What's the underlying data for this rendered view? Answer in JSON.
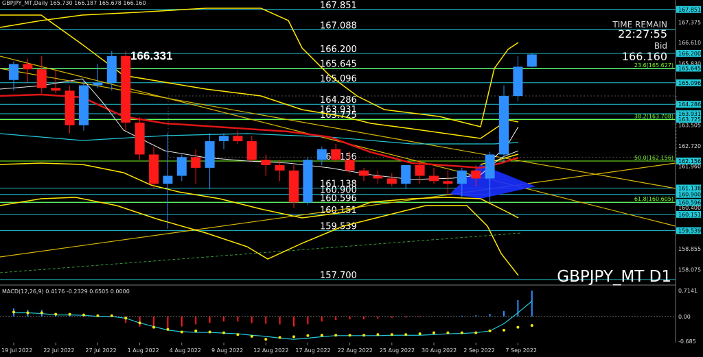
{
  "window": {
    "info_line": "GBPJPY_MT,Daily  165.730 166.187 165.678 166.160",
    "symbol_label": "GBPJPY_MT D1",
    "time_remain_label": "TIME REMAIN",
    "time_remain_value": "22:27:55",
    "bid_label": "Bid",
    "bid_value": "166.160",
    "highlight_price": "166.331"
  },
  "colors": {
    "bull": "#2f8fff",
    "bear": "#ff1a1a",
    "yellow": "#ffe600",
    "cyan": "#22c8d8",
    "red_ma": "#e01515",
    "lime": "#7cff2a",
    "bg": "#000000"
  },
  "chart_data": {
    "type": "candlestick",
    "symbol": "GBPJPY_MT",
    "timeframe": "D1",
    "ylim": [
      157.7,
      168.0
    ],
    "y_ticks": [
      "167.851",
      "167.375",
      "166.610",
      "166.200",
      "165.830",
      "165.645",
      "165.096",
      "164.286",
      "163.931",
      "163.725",
      "163.505",
      "162.720",
      "162.156",
      "161.960",
      "161.138",
      "160.900",
      "160.596",
      "160.400",
      "160.151",
      "159.539",
      "158.855",
      "158.075"
    ],
    "x_tick_labels": [
      "19 Jul 2022",
      "22 Jul 2022",
      "27 Jul 2022",
      "1 Aug 2022",
      "4 Aug 2022",
      "9 Aug 2022",
      "12 Aug 2022",
      "17 Aug 2022",
      "22 Aug 2022",
      "25 Aug 2022",
      "30 Aug 2022",
      "2 Sep 2022",
      "7 Sep 2022"
    ],
    "x_tick_index": [
      0,
      3,
      6,
      9,
      12,
      15,
      18,
      21,
      24,
      27,
      30,
      33,
      36
    ],
    "level_lines": [
      {
        "price": 167.851,
        "label": "167.851"
      },
      {
        "price": 167.088,
        "label": "167.088"
      },
      {
        "price": 166.2,
        "label": "166.200"
      },
      {
        "price": 165.645,
        "label": "165.645"
      },
      {
        "price": 165.096,
        "label": "165.096"
      },
      {
        "price": 164.286,
        "label": "164.286"
      },
      {
        "price": 163.931,
        "label": "163.931"
      },
      {
        "price": 163.725,
        "label": "163.725"
      },
      {
        "price": 162.156,
        "label": "162.156"
      },
      {
        "price": 161.138,
        "label": "161.138"
      },
      {
        "price": 160.9,
        "label": "160.900"
      },
      {
        "price": 160.596,
        "label": "160.596"
      },
      {
        "price": 160.151,
        "label": "160.151"
      },
      {
        "price": 159.539,
        "label": "159.539"
      },
      {
        "price": 157.7,
        "label": "157.700"
      }
    ],
    "fib_labels": [
      {
        "price": 165.627,
        "label": "23.6(165.627)"
      },
      {
        "price": 163.708,
        "label": "38.2(163.708)"
      },
      {
        "price": 162.156,
        "label": "50.0(162.156)"
      },
      {
        "price": 160.605,
        "label": "61.8(160.605)"
      }
    ],
    "candles": [
      {
        "o": 165.2,
        "h": 165.9,
        "l": 164.8,
        "c": 165.8
      },
      {
        "o": 165.8,
        "h": 166.0,
        "l": 165.1,
        "c": 165.6
      },
      {
        "o": 165.6,
        "h": 166.1,
        "l": 164.7,
        "c": 164.9
      },
      {
        "o": 164.9,
        "h": 165.6,
        "l": 164.7,
        "c": 164.8
      },
      {
        "o": 164.8,
        "h": 165.0,
        "l": 163.2,
        "c": 163.5
      },
      {
        "o": 163.5,
        "h": 165.2,
        "l": 163.3,
        "c": 165.0
      },
      {
        "o": 165.0,
        "h": 165.8,
        "l": 164.9,
        "c": 165.1
      },
      {
        "o": 165.1,
        "h": 166.3,
        "l": 164.8,
        "c": 166.1
      },
      {
        "o": 166.1,
        "h": 166.3,
        "l": 163.3,
        "c": 163.6
      },
      {
        "o": 163.6,
        "h": 163.8,
        "l": 162.2,
        "c": 162.4
      },
      {
        "o": 162.4,
        "h": 162.7,
        "l": 161.1,
        "c": 161.3
      },
      {
        "o": 161.3,
        "h": 163.2,
        "l": 159.6,
        "c": 161.6
      },
      {
        "o": 161.6,
        "h": 162.4,
        "l": 161.4,
        "c": 162.3
      },
      {
        "o": 162.3,
        "h": 162.6,
        "l": 161.3,
        "c": 161.9
      },
      {
        "o": 161.9,
        "h": 163.2,
        "l": 161.1,
        "c": 162.9
      },
      {
        "o": 162.9,
        "h": 163.2,
        "l": 162.6,
        "c": 163.1
      },
      {
        "o": 163.1,
        "h": 163.3,
        "l": 162.8,
        "c": 162.9
      },
      {
        "o": 162.9,
        "h": 163.1,
        "l": 162.1,
        "c": 162.2
      },
      {
        "o": 162.2,
        "h": 162.4,
        "l": 161.6,
        "c": 162.0
      },
      {
        "o": 162.0,
        "h": 162.2,
        "l": 161.4,
        "c": 161.8
      },
      {
        "o": 161.8,
        "h": 162.0,
        "l": 160.4,
        "c": 160.6
      },
      {
        "o": 160.6,
        "h": 162.3,
        "l": 160.5,
        "c": 162.2
      },
      {
        "o": 162.2,
        "h": 162.7,
        "l": 162.0,
        "c": 162.6
      },
      {
        "o": 162.6,
        "h": 162.8,
        "l": 162.1,
        "c": 162.2
      },
      {
        "o": 162.2,
        "h": 162.5,
        "l": 161.7,
        "c": 161.8
      },
      {
        "o": 161.8,
        "h": 161.9,
        "l": 161.4,
        "c": 161.6
      },
      {
        "o": 161.6,
        "h": 161.8,
        "l": 161.3,
        "c": 161.5
      },
      {
        "o": 161.5,
        "h": 161.7,
        "l": 161.2,
        "c": 161.3
      },
      {
        "o": 161.3,
        "h": 162.0,
        "l": 161.1,
        "c": 162.0
      },
      {
        "o": 162.0,
        "h": 162.2,
        "l": 161.3,
        "c": 161.6
      },
      {
        "o": 161.6,
        "h": 161.9,
        "l": 161.3,
        "c": 161.4
      },
      {
        "o": 161.4,
        "h": 161.8,
        "l": 160.9,
        "c": 161.3
      },
      {
        "o": 161.3,
        "h": 161.9,
        "l": 160.8,
        "c": 161.8
      },
      {
        "o": 161.8,
        "h": 162.0,
        "l": 161.2,
        "c": 161.5
      },
      {
        "o": 161.5,
        "h": 162.5,
        "l": 160.6,
        "c": 162.4
      },
      {
        "o": 162.4,
        "h": 165.0,
        "l": 162.1,
        "c": 164.6
      },
      {
        "o": 164.6,
        "h": 166.1,
        "l": 164.4,
        "c": 165.7
      },
      {
        "o": 165.7,
        "h": 166.19,
        "l": 165.68,
        "c": 166.16
      }
    ],
    "macd": {
      "label": "MACD(12,26,9) 0.4176 -0.2329 0.6505 0.0000",
      "ylim": [
        -0.685,
        0.7141
      ],
      "y_ticks": [
        "0.7141",
        "0.00",
        "-0.685"
      ],
      "histogram": [
        0.22,
        0.18,
        0.18,
        0.1,
        0.05,
        0.05,
        0.05,
        0.04,
        -0.18,
        -0.28,
        -0.33,
        -0.33,
        -0.28,
        -0.22,
        -0.18,
        -0.14,
        -0.14,
        -0.18,
        -0.2,
        -0.22,
        -0.28,
        -0.22,
        -0.14,
        -0.1,
        -0.08,
        -0.08,
        -0.06,
        -0.04,
        -0.03,
        -0.02,
        0.0,
        0.01,
        0.02,
        0.03,
        0.07,
        0.15,
        0.45,
        0.71
      ],
      "signal": [
        0.1,
        0.1,
        0.08,
        0.04,
        0.04,
        0.03,
        0.0,
        0.0,
        -0.05,
        -0.18,
        -0.28,
        -0.38,
        -0.42,
        -0.44,
        -0.44,
        -0.46,
        -0.48,
        -0.52,
        -0.55,
        -0.6,
        -0.63,
        -0.6,
        -0.56,
        -0.53,
        -0.53,
        -0.53,
        -0.53,
        -0.52,
        -0.52,
        -0.52,
        -0.5,
        -0.48,
        -0.47,
        -0.45,
        -0.4,
        -0.2,
        0.1,
        0.42
      ],
      "dots": [
        0.12,
        0.1,
        0.1,
        0.06,
        0.06,
        0.04,
        0.02,
        0.02,
        -0.05,
        -0.18,
        -0.3,
        -0.36,
        -0.43,
        -0.4,
        -0.43,
        -0.45,
        -0.5,
        -0.55,
        -0.63,
        -0.58,
        -0.56,
        -0.53,
        -0.52,
        -0.52,
        -0.52,
        -0.52,
        -0.5,
        -0.5,
        -0.5,
        -0.48,
        -0.45,
        -0.45,
        -0.45,
        -0.45,
        -0.4,
        -0.38,
        -0.3,
        -0.25
      ]
    }
  }
}
